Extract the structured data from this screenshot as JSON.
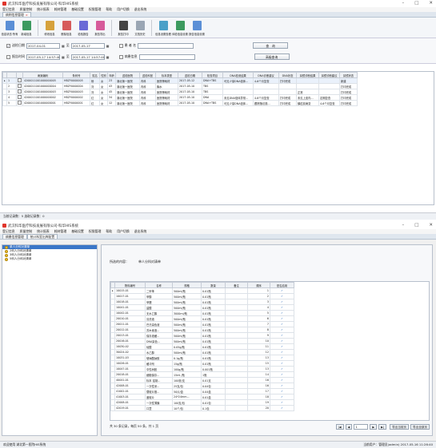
{
  "win1": {
    "title": "武汉科华医疗科技发展有限公司-科华HIS系统",
    "menu": [
      "登记信息",
      "质量控制",
      "统计报表",
      "耗材管理",
      "基础设置",
      "权限管理",
      "帮助",
      "用户切换",
      "退出系统"
    ],
    "tab": "病例信息管理",
    "toolbar": [
      "信息状态·所有",
      "新增信息",
      "修改信息",
      "删除信息",
      "检验报告",
      "报告导出",
      "报告打印",
      "文档历史",
      "信息设置查看",
      "体检信息设置",
      "报告信息设置"
    ],
    "filters": {
      "reg_date_label": "送检日期",
      "reg_from": "2017-04-01",
      "reg_to": "2017-05-17",
      "to_label": "至",
      "name_label": "患 者 名",
      "query_button": "查　询",
      "print_date_label": "报告时间",
      "print_from": "2017-05-17 14:57:48",
      "print_to": "2017-05-17 14:57:48",
      "info_label": "病患信息",
      "export_button": "高级查询"
    },
    "table": {
      "headers": [
        "",
        "",
        "",
        "病案编码",
        "条码号",
        "姓名",
        "性别",
        "年龄",
        "送检医院",
        "送检科室",
        "标本类型",
        "送检日期",
        "检查项目",
        "DNA检测结果",
        "DNA诊断建议",
        "DNA状态",
        "耳镜诊断结果",
        "耳镜诊断建议",
        "耳镜状态"
      ],
      "rows": [
        [
          "▸",
          "1",
          "",
          "4200011001000000005",
          "HBZY0000005",
          "杨",
          "女",
          "23",
          "湖北第一医院",
          "内科",
          "医院等耗材",
          "2017-05-12",
          "DNA+TBS",
          "可见少量DNA倍体...",
          "4-6个月复查",
          "打印完成",
          "",
          "",
          "新建"
        ],
        [
          "",
          "2",
          "",
          "4200011001000000004",
          "HBZY0000004",
          "刘",
          "女",
          "43",
          "湖北第一医院",
          "内科",
          "胸水",
          "2017-05-10",
          "TBS",
          "",
          "",
          "",
          "",
          "",
          "打印完成"
        ],
        [
          "",
          "3",
          "",
          "4200011001000000003",
          "HBZY0000003",
          "刘",
          "女",
          "45",
          "湖北第一医院",
          "内科",
          "医院等耗材",
          "2017-05-10",
          "TBS",
          "",
          "",
          "",
          "正常",
          "",
          "打印完成"
        ],
        [
          "",
          "4",
          "",
          "4200011001000000002",
          "HBZY0000002",
          "红",
          "女",
          "34",
          "湖北第一医院",
          "内科",
          "医院等耗材",
          "2017-05-10",
          "DNA",
          "未见DNA倍体异常...",
          "4-6个月复查",
          "打印完成",
          "未见上皮内...",
          "定期复查",
          "打印完成"
        ],
        [
          "",
          "5",
          "",
          "4200011001000000001",
          "HBZY0000001",
          "红",
          "女",
          "12",
          "湖北第一医院",
          "内科",
          "医院等耗材",
          "2017-05-10",
          "DNA+TBS",
          "可见少量DNA倍体...",
          "跟踪随访观...",
          "打印完成",
          "鳞癌前病变",
          "4-6个月复查",
          "打印完成"
        ]
      ]
    },
    "status": "当前记录数：5  选取记录数：0"
  },
  "win2": {
    "title": "武汉科华医疗科技发展有限公司-科华HIS系统",
    "menu": [
      "登记信息",
      "质量控制",
      "统计报表",
      "耗材管理",
      "基础设置",
      "权限管理",
      "帮助",
      "用户切换",
      "退出系统"
    ],
    "tabs": [
      "病患信息管理",
      "统计科室出库配置"
    ],
    "tree": [
      "单人分科对清单",
      "2科人分科对清单",
      "3科人分科对清单",
      "5科人分科对清单"
    ],
    "selected_label": "所选的内容：",
    "selected_value": "单人分科对清单",
    "table": {
      "headers": [
        "",
        "物料编号",
        "名称",
        "规格",
        "数量",
        "备注",
        "顺序",
        "是否启用"
      ],
      "rows": [
        [
          "▸",
          "10015-01",
          "二甲苯",
          "500ml/瓶",
          "0.01瓶",
          "",
          "1",
          "✓"
        ],
        [
          "",
          "10017-01",
          "甲醇",
          "500ml/瓶",
          "0.01瓶",
          "",
          "2",
          "✓"
        ],
        [
          "",
          "10018-01",
          "甲醛",
          "500ml/瓶",
          "0.01瓶",
          "",
          "3",
          "✓"
        ],
        [
          "",
          "10041-01",
          "盐酸",
          "500ml/瓶",
          "0.01瓶",
          "",
          "4",
          "✓"
        ],
        [
          "",
          "10042-01",
          "无水乙醇",
          "3000ml/瓶",
          "0.01瓶",
          "",
          "5",
          "✓"
        ],
        [
          "",
          "20010-01",
          "清洗液",
          "500ml/瓶",
          "0.01瓶",
          "",
          "6",
          "✓"
        ],
        [
          "",
          "20011-01",
          "巴氏染色液",
          "500ml/瓶",
          "0.01瓶",
          "",
          "7",
          "✓"
        ],
        [
          "",
          "20012-01",
          "苏木素液...",
          "500ml/瓶",
          "0.01瓶",
          "",
          "8",
          "✓"
        ],
        [
          "",
          "20013-01",
          "保存液缓...",
          "500ml/瓶",
          "0.01瓶",
          "",
          "9",
          "✓"
        ],
        [
          "",
          "20016-01",
          "DNA染色...",
          "500ml/瓶",
          "0.01瓶",
          "",
          "10",
          "✓"
        ],
        [
          "",
          "10030-02",
          "硅酸",
          "0.05g/瓶",
          "0.01瓶",
          "",
          "11",
          "✓"
        ],
        [
          "",
          "30024-02",
          "水乙醇",
          "500ml/瓶",
          "0.01瓶",
          "",
          "12",
          "✓"
        ],
        [
          "",
          "10031-03",
          "玻璃酸钠胶",
          "0.1g/瓶",
          "0.01瓶",
          "",
          "13",
          "✓"
        ],
        [
          "",
          "10026-01",
          "缓冲剂",
          "15g/瓶",
          "0.01瓶",
          "",
          "15",
          "✓"
        ],
        [
          "",
          "10047-01",
          "中性树胶",
          "100g/瓶",
          "0.001瓶",
          "",
          "13",
          "✓"
        ],
        [
          "",
          "20018-01",
          "细胞保存...",
          "15ml /瓶",
          "1瓶",
          "",
          "14",
          "✓"
        ],
        [
          "",
          "40041-01",
          "标本 铝制...",
          "100张/支",
          "0.01支",
          "",
          "16",
          "✓"
        ],
        [
          "",
          "42008-01",
          "一次性采...",
          "25支/包",
          "0.04包",
          "",
          "16",
          "✓"
        ],
        [
          "",
          "41002-01",
          "载玻片推...",
          "50片/盒",
          "0.04盒",
          "",
          "17",
          "✓"
        ],
        [
          "",
          "41003-01",
          "盖玻片",
          "24*24mm...",
          "0.01盒",
          "",
          "18",
          "✓"
        ],
        [
          "",
          "42008-01",
          "一次性薄膜",
          "100支/包",
          "0.01包",
          "",
          "19",
          "✓"
        ],
        [
          "",
          "42019-01",
          "口罩",
          "10个/包",
          "0.1包",
          "",
          "20",
          "✓"
        ]
      ]
    },
    "pager": {
      "summary": "共 30 条记录，每页 50 条，共 1 页",
      "page": "1",
      "export_page": "导出当前页",
      "export_all": "导出全部页"
    },
    "status_left": "欢迎使用 湖北第一医院HIS系统",
    "status_right": "当前用户：管理员(admin)  2017-05-16 11:26:40"
  },
  "colors": {
    "accent": "#3a76c8",
    "grid_header": "#eef1f5"
  }
}
